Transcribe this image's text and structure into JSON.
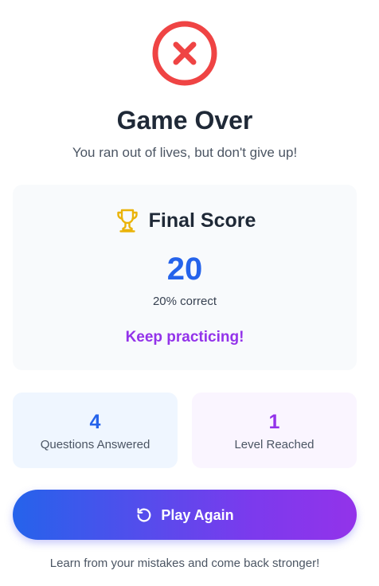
{
  "header": {
    "status_icon": "x-circle-icon",
    "status_color": "#ef4444",
    "title": "Game Over",
    "subtitle": "You ran out of lives, but don't give up!"
  },
  "score_card": {
    "icon": "trophy-icon",
    "icon_color": "#eab308",
    "title": "Final Score",
    "score": "20",
    "percent_text": "20% correct",
    "message": "Keep practicing!"
  },
  "stats": {
    "questions": {
      "value": "4",
      "label": "Questions Answered"
    },
    "level": {
      "value": "1",
      "label": "Level Reached"
    }
  },
  "actions": {
    "play_again_icon": "restart-icon",
    "play_again_label": "Play Again"
  },
  "footer": {
    "text": "Learn from your mistakes and come back stronger!"
  },
  "colors": {
    "primary_blue": "#2563eb",
    "accent_purple": "#9333ea",
    "text_dark": "#1f2937",
    "text_muted": "#4b5563"
  }
}
